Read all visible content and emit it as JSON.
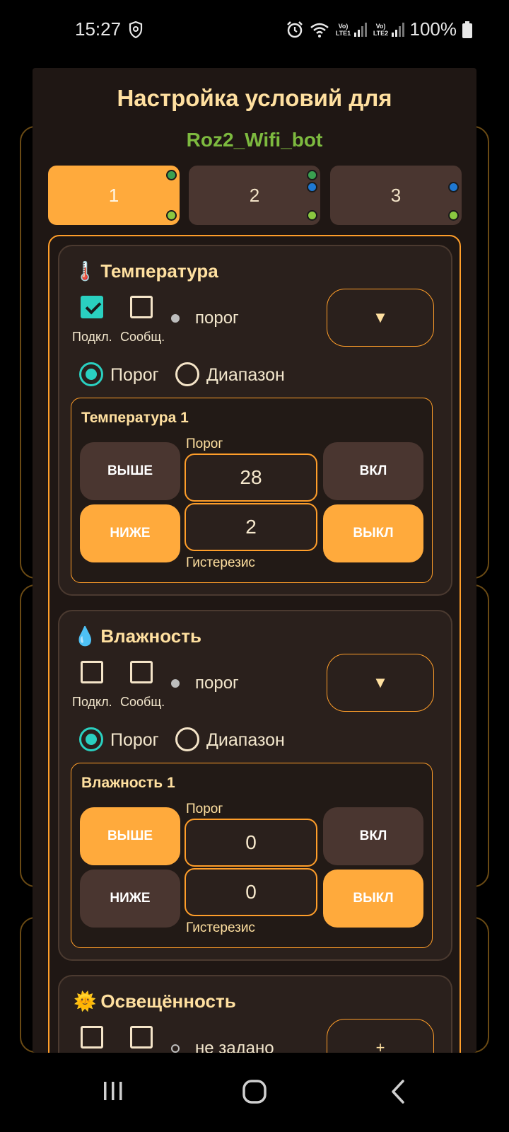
{
  "status": {
    "time": "15:27",
    "sim1": "Vo) LTE1",
    "sim2": "Vo) LTE2",
    "battery": "100%"
  },
  "dialog": {
    "title": "Настройка условий для",
    "subtitle": "Roz2_Wifi_bot",
    "tabs": [
      {
        "label": "1",
        "active": true
      },
      {
        "label": "2",
        "active": false
      },
      {
        "label": "3",
        "active": false
      }
    ]
  },
  "common": {
    "connect_label": "Подкл.",
    "notify_label": "Сообщ.",
    "radio_threshold": "Порог",
    "radio_range": "Диапазон",
    "threshold_label": "Порог",
    "hysteresis_label": "Гистерезис",
    "above": "ВЫШЕ",
    "below": "НИЖЕ",
    "on": "ВКЛ",
    "off": "ВЫКЛ",
    "dropdown_arrow": "▼"
  },
  "sensors": [
    {
      "icon": "🌡️",
      "name": "Температура",
      "connect_checked": true,
      "notify_checked": false,
      "mode": "порог",
      "condition_title": "Температура 1",
      "threshold": "28",
      "hysteresis": "2",
      "selected_direction": "below",
      "selected_action": "off"
    },
    {
      "icon": "💧",
      "name": "Влажность",
      "connect_checked": false,
      "notify_checked": false,
      "mode": "порог",
      "condition_title": "Влажность 1",
      "threshold": "0",
      "hysteresis": "0",
      "selected_direction": "above",
      "selected_action": "off"
    },
    {
      "icon": "🌞",
      "name": "Освещённость",
      "connect_checked": false,
      "notify_checked": false,
      "mode": "не задано",
      "add_label": "+"
    }
  ],
  "colors": {
    "accent": "#ffaa3c",
    "teal": "#2ad0c0",
    "bot_name": "#7dba3f"
  }
}
